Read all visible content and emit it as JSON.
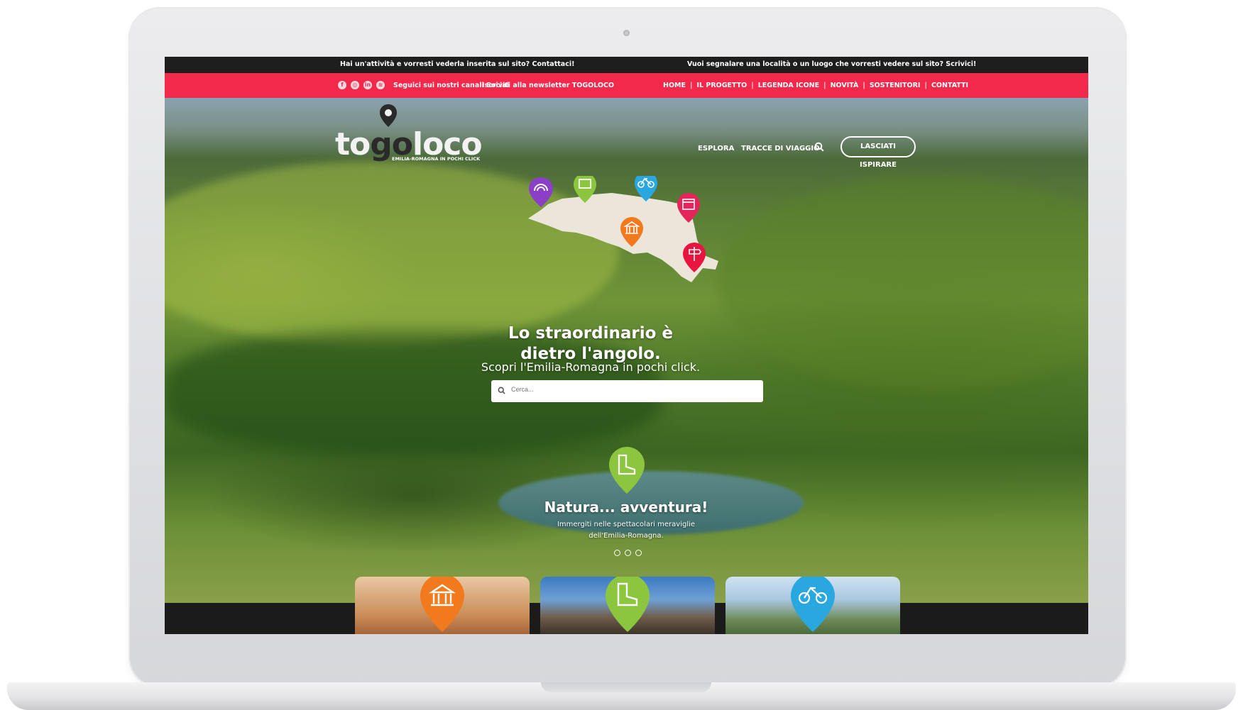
{
  "topbar": {
    "left_text": "Hai un'attività e vorresti vederla inserita sul sito? Contattaci!",
    "right_text": "Vuoi segnalare una località o un luogo che vorresti vedere sul sito? Scrivici!"
  },
  "redbar": {
    "social_text": "Seguici sui nostri canali Social",
    "newsletter_text": "Iscriviti alla newsletter TOGOLOCO",
    "menu": [
      "HOME",
      "IL PROGETTO",
      "LEGENDA ICONE",
      "NOVITÀ",
      "SOSTENITORI",
      "CONTATTI"
    ]
  },
  "logo": {
    "word_a": "to",
    "word_b": "go",
    "word_c": "loco",
    "sub": "EMILIA-ROMAGNA IN POCHI CLICK"
  },
  "nav": {
    "explore": "ESPLORA",
    "tracks": "TRACCE DI VIAGGIO",
    "cta": "LASCIATI ISPIRARE"
  },
  "hero": {
    "headline": "Lo straordinario è dietro l'angolo.",
    "subline": "Scopri l'Emilia-Romagna in pochi click.",
    "search_placeholder": "Cerca..."
  },
  "slide": {
    "title": "Natura... avventura!",
    "text": "Immergiti nelle spettacolari meraviglie dell'Emilia-Romagna.",
    "dots": 3
  },
  "colors": {
    "brand_red": "#f2294b",
    "pin_purple": "#8b3fc6",
    "pin_green": "#8cc63f",
    "pin_blue": "#29a8e0",
    "pin_pink": "#e6245c",
    "pin_orange": "#f07a1d",
    "pin_red": "#e8163f"
  },
  "icons": [
    "facebook-icon",
    "instagram-icon",
    "linkedin-icon",
    "spotify-icon",
    "search-icon",
    "rainbow-icon",
    "map-icon",
    "bike-icon",
    "calendar-icon",
    "museum-icon",
    "signpost-icon"
  ]
}
